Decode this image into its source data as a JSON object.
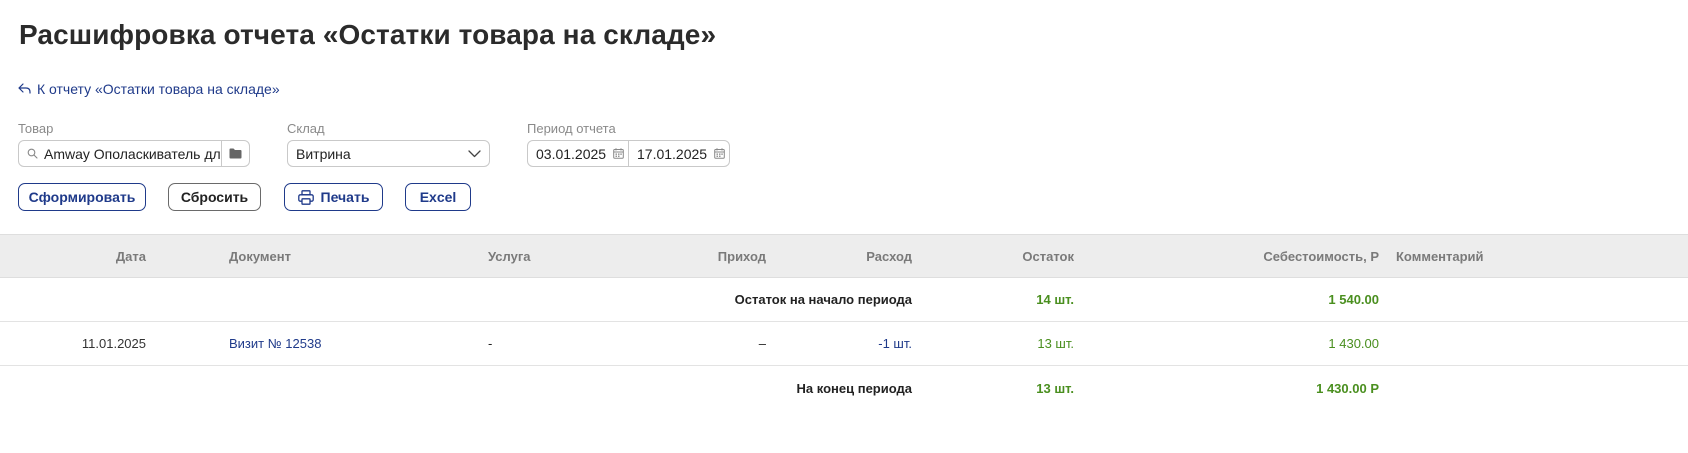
{
  "page": {
    "title": "Расшифровка отчета «Остатки товара на складе»",
    "back_link": "К отчету «Остатки товара на складе»"
  },
  "filters": {
    "product": {
      "label": "Товар",
      "value": "Amway Ополаскиватель дл"
    },
    "warehouse": {
      "label": "Склад",
      "value": "Витрина"
    },
    "period": {
      "label": "Период отчета",
      "from": "03.01.2025",
      "to": "17.01.2025"
    }
  },
  "buttons": {
    "form": "Сформировать",
    "reset": "Сбросить",
    "print": "Печать",
    "excel": "Excel"
  },
  "table": {
    "headers": {
      "date": "Дата",
      "document": "Документ",
      "service": "Услуга",
      "income": "Приход",
      "expense": "Расход",
      "balance": "Остаток",
      "cost": "Себестоимость, Р",
      "comment": "Комментарий"
    },
    "opening": {
      "label": "Остаток на начало периода",
      "balance": "14 шт.",
      "cost": "1 540.00"
    },
    "rows": [
      {
        "date": "11.01.2025",
        "document": "Визит № 12538",
        "service": "-",
        "income": "–",
        "expense": "-1 шт.",
        "balance": "13 шт.",
        "cost": "1 430.00",
        "comment": ""
      }
    ],
    "closing": {
      "label": "На конец периода",
      "balance": "13 шт.",
      "cost": "1 430.00 Р"
    }
  },
  "colors": {
    "accent": "#1f3a8a",
    "positive": "#4a8f1f",
    "header_bg": "#ededed"
  }
}
